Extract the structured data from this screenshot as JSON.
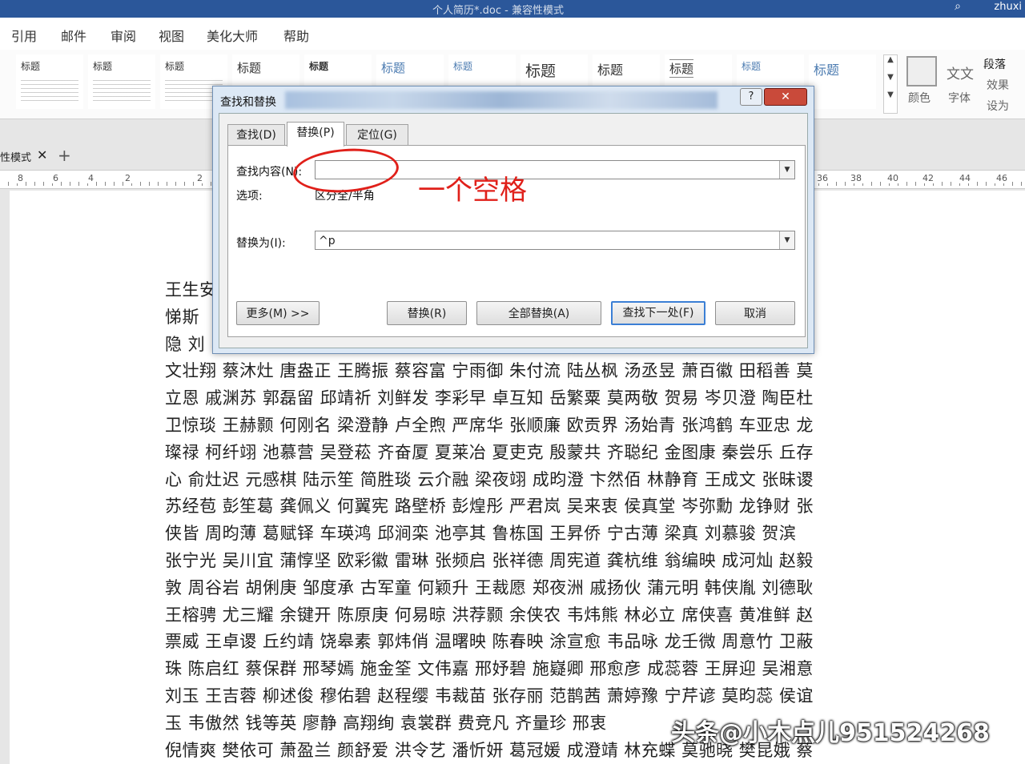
{
  "window": {
    "title": "个人简历*.doc - 兼容性模式",
    "user": "zhuxi"
  },
  "menu": {
    "items": [
      "引用",
      "邮件",
      "审阅",
      "视图",
      "美化大师",
      "帮助"
    ]
  },
  "ribbon": {
    "styles": [
      "标题",
      "标题",
      "标题",
      "标题",
      "标题",
      "标题",
      "标题",
      "标题",
      "标题",
      "标题",
      "标题",
      "标题",
      "标题"
    ],
    "right": {
      "wenzi": "文文",
      "color": "颜色",
      "font": "字体",
      "paragraph": "段落",
      "effect": "效果",
      "setas": "设为"
    }
  },
  "doctab": {
    "label": "性模式",
    "close": "✕",
    "add": "+"
  },
  "ruler": {
    "ticks": [
      "8",
      "6",
      "4",
      "2",
      "2",
      "36",
      "38",
      "40",
      "42",
      "44",
      "46"
    ]
  },
  "dialog": {
    "title": "查找和替换",
    "help": "?",
    "close": "✕",
    "tabs": [
      "查找(D)",
      "替换(P)",
      "定位(G)"
    ],
    "find_label": "查找内容(N):",
    "find_value": "",
    "options_label": "选项:",
    "options_value": "区分全/半角",
    "replace_label": "替换为(I):",
    "replace_value": "^p",
    "buttons": {
      "more": "更多(M) >>",
      "replace": "替换(R)",
      "replace_all": "全部替换(A)",
      "find_next": "查找下一处(F)",
      "cancel": "取消"
    }
  },
  "annotation": {
    "text": "一个空格",
    "color": "#e0201a"
  },
  "document": {
    "text": "王生安                                                                                           顺谷 张\n悌斯                                                                                            鉴 王好\n隐 刘                                                                                          卢钦钧\n文壮翔 蔡沐灶 唐盎正 王腾振 蔡容富 宁雨御 朱付流 陆丛枫 汤丞昱 萧百徽 田稻善 莫\n立恩 戚渊苏 郭磊留 邱靖祈 刘鲜发 李彩早 卓互知 岳繁粟 莫两敬 贺易 岑贝澄 陶臣杜\n卫惊琰 王赫颢 何刚名 梁澄静 卢全煦 严席华 张顺廉 欧贡界 汤始青 张鸿鹤 车亚忠 龙\n璨禄 柯纤翊 池慕营 吴登菘 齐奋厦 夏莱冶 夏吏克 殷蒙共 齐聪纪 金图康 秦尝乐 丘存\n心 俞灶迟 元感棋 陆示笙 简胜琰 云介融 梁夜翊 成昀澄 卞然佰 林静育 王成文 张昧谡\n苏经苞 彭笙葛 龚佩义 何翼宪 路壁桥 彭煌彤 严君岚 吴来衷 侯真堂 岑弥勳 龙铮财 张\n侠皆 周昀薄 葛赋铎 车瑛鸿 邱涧栾 池亭其 鲁栋国 王昇侨 宁古薄 梁真 刘慕骏 贺滨\n张宁光 吴川宜 蒲惇坚 欧彩徽 雷琳 张频启 张祥德 周宪道 龚杭维 翁编映 成河灿 赵毅\n敦 周谷岩 胡俐庚 邹度承 古军童 何颖升 王裁愿 郑夜洲 戚扬伙 蒲元明 韩侠胤 刘德耿\n王榕骋 尤三耀 余键开 陈原庚 何易晾 洪荐颢 余侠农 韦炜熊 林必立 席侠喜 黄准鲜 赵\n票威 王卓谡 丘约靖 饶皋素 郭炜俏 温曙映 陈春映 涂宣愈 韦品咏 龙壬微 周意竹 卫蔽\n珠 陈启红 蔡保群 邢琴嫣 施金筌 文伟嘉 邢妤碧 施嶷卿 邢愈彦 成蕊蓉 王屏迎 吴湘意\n刘玉 王吉蓉 柳述俊 穆佑碧 赵程缨 韦裁苗 张存丽 范鹊茜 萧婷豫 宁芹谚 莫昀蕊 侯谊\n玉 韦傲然 钱等英 廖静 高翔绚 袁裳群 费竞凡 齐量珍 邢衷\n倪情爽 樊依可 萧盈兰 颜舒爱 洪令艺 潘忻妍 葛冠媛 成澄靖 林充蝶 莫驰晓 樊昆娥 蔡"
  },
  "watermark": {
    "text": "头条@小木点儿951524268"
  }
}
